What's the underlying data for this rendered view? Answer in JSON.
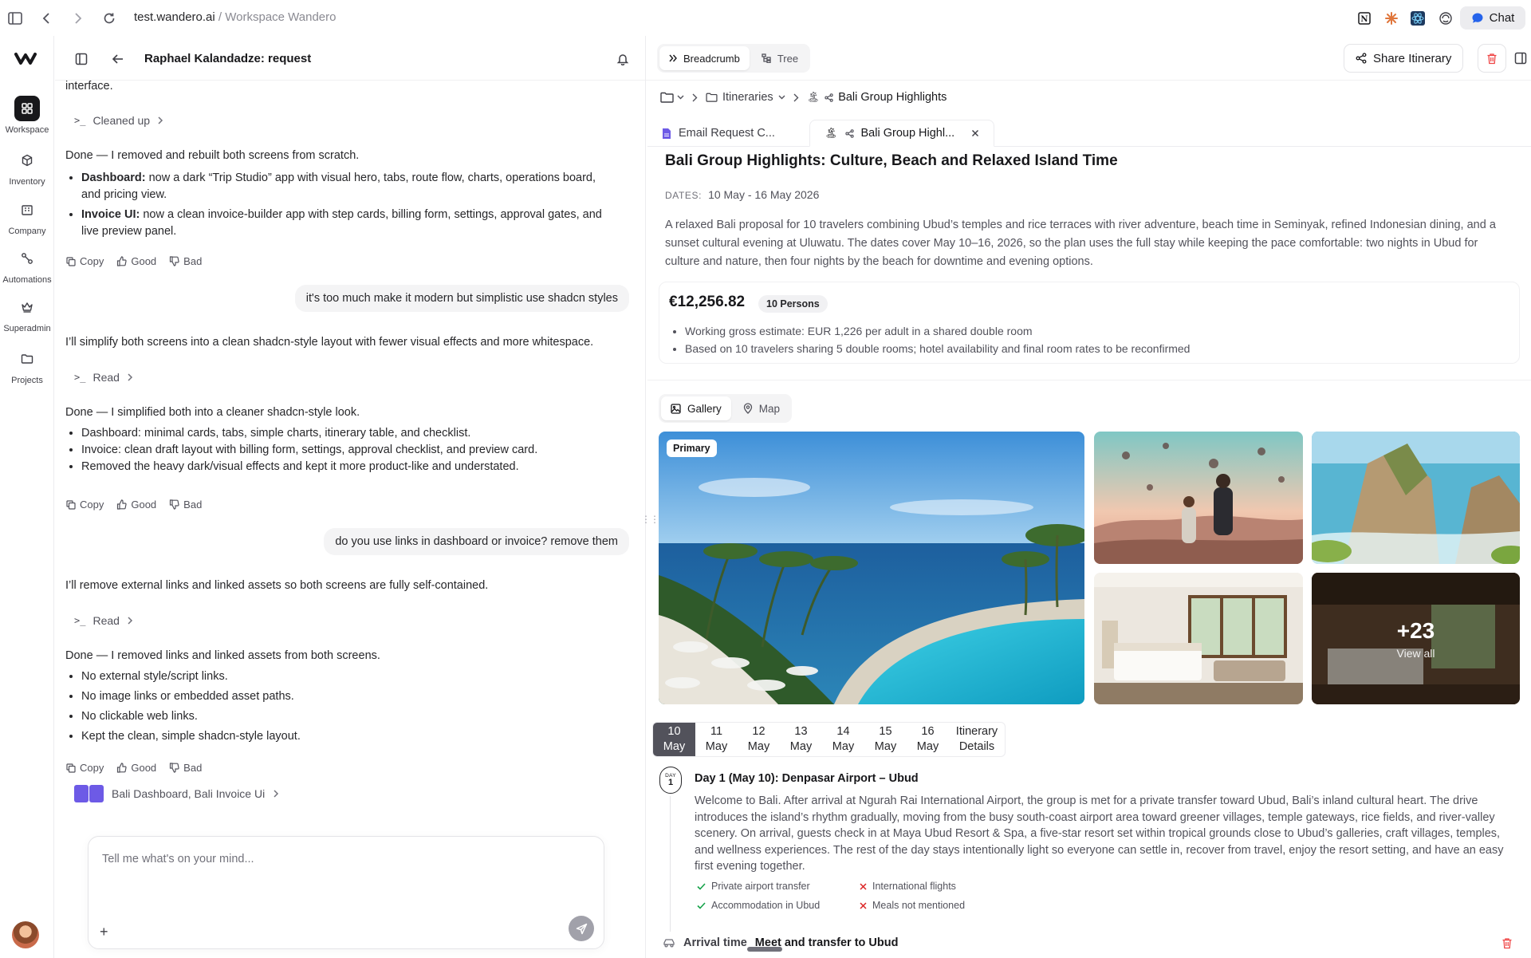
{
  "browser": {
    "url_host": "test.wandero.ai",
    "url_sep": " / ",
    "url_title": "Workspace Wandero",
    "chat_button": "Chat"
  },
  "rail": {
    "items": [
      {
        "label": "Workspace",
        "icon": "grid-icon"
      },
      {
        "label": "Inventory",
        "icon": "cube-icon"
      },
      {
        "label": "Company",
        "icon": "building-icon"
      },
      {
        "label": "Automations",
        "icon": "flow-icon"
      },
      {
        "label": "Superadmin",
        "icon": "crown-icon"
      },
      {
        "label": "Projects",
        "icon": "folder-icon"
      }
    ]
  },
  "chat": {
    "title": "Raphael Kalandadze: request",
    "top_fragment": "interface.",
    "tool1": "Cleaned up",
    "msg1": "Done — I removed and rebuilt both screens from scratch.",
    "msg1_bullets": [
      {
        "bold": "Dashboard:",
        "text": " now a dark “Trip Studio” app with visual hero, tabs, route flow, charts, operations board, and pricing view."
      },
      {
        "bold": "Invoice UI:",
        "text": " now a clean invoice-builder app with step cards, billing form, settings, approval gates, and live preview panel."
      }
    ],
    "copy": "Copy",
    "good": "Good",
    "bad": "Bad",
    "user1": "it's too much make it modern but simplistic use shadcn styles",
    "msg2": "I’ll simplify both screens into a clean shadcn-style layout with fewer visual effects and more whitespace.",
    "tool2": "Read",
    "msg3": "Done — I simplified both into a cleaner shadcn-style look.",
    "msg3_bullets": [
      "Dashboard: minimal cards, tabs, simple charts, itinerary table, and checklist.",
      "Invoice: clean draft layout with billing form, settings, approval checklist, and preview card.",
      "Removed the heavy dark/visual effects and kept it more product-like and understated."
    ],
    "user2": "do you use links in dashboard or invoice? remove them",
    "msg4": "I’ll remove external links and linked assets so both screens are fully self-contained.",
    "tool3": "Read",
    "msg5": "Done — I removed links and linked assets from both screens.",
    "msg5_bullets": [
      "No external style/script links.",
      "No image links or embedded asset paths.",
      "No clickable web links.",
      "Kept the clean, simple shadcn-style layout."
    ],
    "attachments": "Bali Dashboard, Bali Invoice Ui",
    "composer_placeholder": "Tell me what's on your mind..."
  },
  "right": {
    "view_toggle": {
      "breadcrumb": "Breadcrumb",
      "tree": "Tree"
    },
    "share": "Share Itinerary",
    "crumbs": {
      "folder": "Itineraries",
      "current": "Bali Group Highlights"
    },
    "tabs": [
      {
        "label": "Email Request C..."
      },
      {
        "label": "Bali Group Highl..."
      }
    ],
    "title": "Bali Group Highlights: Culture, Beach and Relaxed Island Time",
    "dates_label": "DATES:",
    "dates_value": "10 May - 16 May 2026",
    "summary": "A relaxed Bali proposal for 10 travelers combining Ubud’s temples and rice terraces with river adventure, beach time in Seminyak, refined Indonesian dining, and a sunset cultural evening at Uluwatu. The dates cover May 10–16, 2026, so the plan uses the full stay while keeping the pace comfortable: two nights in Ubud for culture and nature, then four nights by the beach for downtime and evening options.",
    "price": "€12,256.82",
    "persons": "10 Persons",
    "price_notes": [
      "Working gross estimate: EUR 1,226 per adult in a shared double room",
      "Based on 10 travelers sharing 5 double rooms; hotel availability and final room rates to be reconfirmed"
    ],
    "gallery_toggle": {
      "gallery": "Gallery",
      "map": "Map"
    },
    "primary_badge": "Primary",
    "more_count": "+23",
    "view_all": "View all",
    "days": [
      {
        "day": "10",
        "month": "May"
      },
      {
        "day": "11",
        "month": "May"
      },
      {
        "day": "12",
        "month": "May"
      },
      {
        "day": "13",
        "month": "May"
      },
      {
        "day": "14",
        "month": "May"
      },
      {
        "day": "15",
        "month": "May"
      },
      {
        "day": "16",
        "month": "May"
      }
    ],
    "itinerary_tab": {
      "line1": "Itinerary",
      "line2": "Details"
    },
    "day1": {
      "badge_label": "DAY",
      "badge_num": "1",
      "title": "Day 1 (May 10): Denpasar Airport – Ubud",
      "desc": "Welcome to Bali. After arrival at Ngurah Rai International Airport, the group is met for a private transfer toward Ubud, Bali’s inland cultural heart. The drive introduces the island’s rhythm gradually, moving from the busy south-coast airport area toward greener villages, temple gateways, rice fields, and river-valley scenery. On arrival, guests check in at Maya Ubud Resort & Spa, a five-star resort set within tropical grounds close to Ubud’s galleries, craft villages, temples, and wellness experiences. The rest of the day stays intentionally light so everyone can settle in, recover from travel, enjoy the resort setting, and have an easy first evening together.",
      "included": [
        "Private airport transfer",
        "Accommodation in Ubud"
      ],
      "excluded": [
        "International flights",
        "Meals not mentioned"
      ],
      "arrival_label": "Arrival time",
      "arrival_value": "Meet and transfer to Ubud"
    }
  },
  "colors": {
    "accent": "#18181b",
    "chat_button_icon": "#2563eb",
    "danger": "#ef4444",
    "check": "#16a34a",
    "cross": "#dc2626"
  }
}
